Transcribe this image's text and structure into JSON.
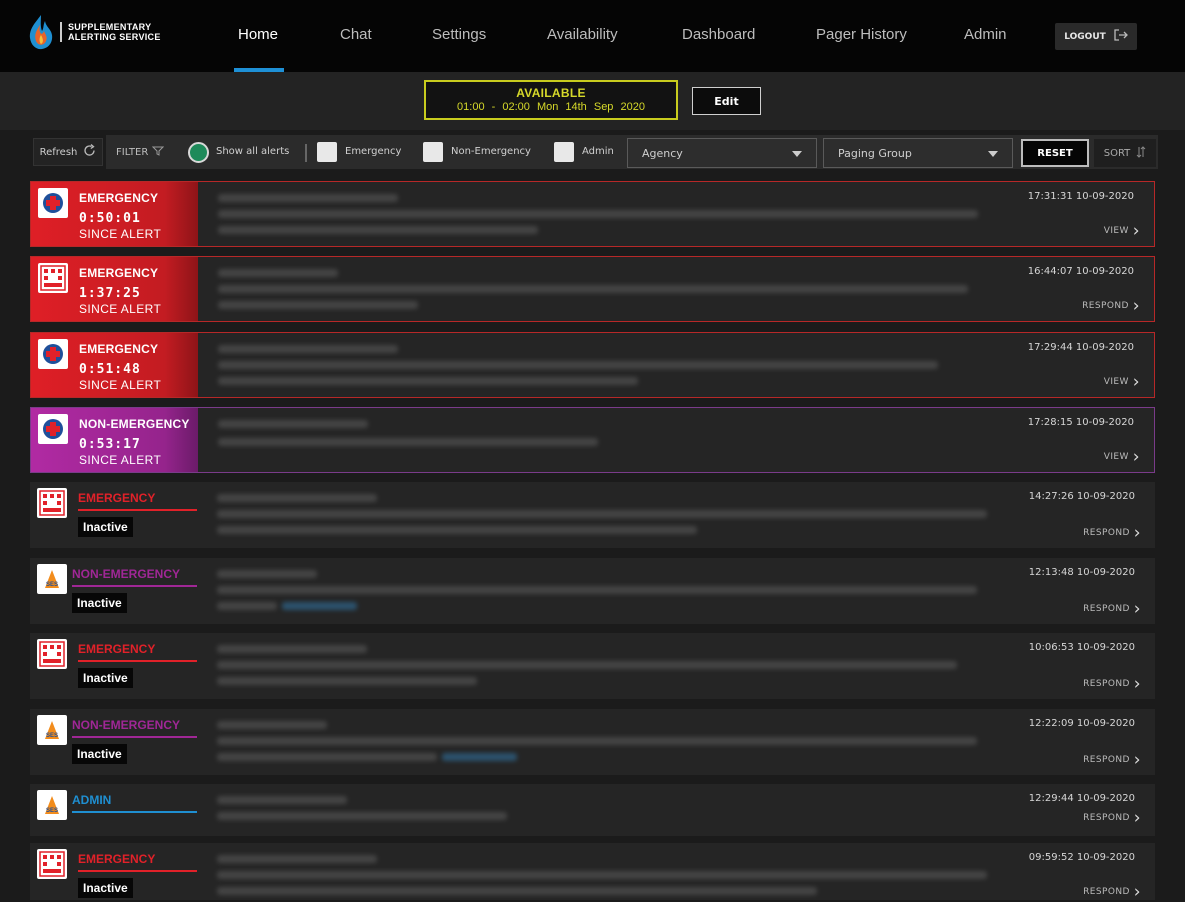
{
  "brand": {
    "line1": "SUPPLEMENTARY",
    "line2": "ALERTING SERVICE"
  },
  "nav": {
    "items": [
      {
        "label": "Home"
      },
      {
        "label": "Chat"
      },
      {
        "label": "Settings"
      },
      {
        "label": "Availability"
      },
      {
        "label": "Dashboard"
      },
      {
        "label": "Pager History"
      },
      {
        "label": "Admin"
      }
    ],
    "logout_label": "LOGOUT"
  },
  "availability": {
    "status": "AVAILABLE",
    "time": "01:00 - 02:00",
    "date": "Mon 14th Sep 2020",
    "edit_label": "Edit"
  },
  "filters": {
    "refresh_label": "Refresh",
    "filter_label": "FILTER",
    "show_all_label": "Show all alerts",
    "emergency_label": "Emergency",
    "non_emergency_label": "Non-Emergency",
    "admin_label": "Admin",
    "agency_placeholder": "Agency",
    "paging_group_placeholder": "Paging Group",
    "reset_label": "RESET",
    "sort_label": "SORT"
  },
  "colors": {
    "emergency": "#e12129",
    "non_emergency": "#a02796",
    "admin": "#1f8fd1",
    "available": "#d6d92a",
    "accent": "#1e90d6"
  },
  "alerts": [
    {
      "type": "EMERGENCY",
      "elapsed": "0:50:01",
      "since": "SINCE ALERT",
      "timestamp": "17:31:31 10-09-2020",
      "action": "VIEW",
      "agency": "cross"
    },
    {
      "type": "EMERGENCY",
      "elapsed": "1:37:25",
      "since": "SINCE ALERT",
      "timestamp": "16:44:07 10-09-2020",
      "action": "RESPOND",
      "agency": "cfa"
    },
    {
      "type": "EMERGENCY",
      "elapsed": "0:51:48",
      "since": "SINCE ALERT",
      "timestamp": "17:29:44 10-09-2020",
      "action": "VIEW",
      "agency": "cross"
    },
    {
      "type": "NON-EMERGENCY",
      "elapsed": "0:53:17",
      "since": "SINCE ALERT",
      "timestamp": "17:28:15 10-09-2020",
      "action": "VIEW",
      "agency": "cross"
    },
    {
      "type": "EMERGENCY",
      "status": "Inactive",
      "timestamp": "14:27:26 10-09-2020",
      "action": "RESPOND",
      "agency": "cfa"
    },
    {
      "type": "NON-EMERGENCY",
      "status": "Inactive",
      "timestamp": "12:13:48 10-09-2020",
      "action": "RESPOND",
      "agency": "ses"
    },
    {
      "type": "EMERGENCY",
      "status": "Inactive",
      "timestamp": "10:06:53 10-09-2020",
      "action": "RESPOND",
      "agency": "cfa"
    },
    {
      "type": "NON-EMERGENCY",
      "status": "Inactive",
      "timestamp": "12:22:09 10-09-2020",
      "action": "RESPOND",
      "agency": "ses"
    },
    {
      "type": "ADMIN",
      "timestamp": "12:29:44 10-09-2020",
      "action": "RESPOND",
      "agency": "ses"
    },
    {
      "type": "EMERGENCY",
      "status": "Inactive",
      "timestamp": "09:59:52 10-09-2020",
      "action": "RESPOND",
      "agency": "cfa"
    }
  ]
}
